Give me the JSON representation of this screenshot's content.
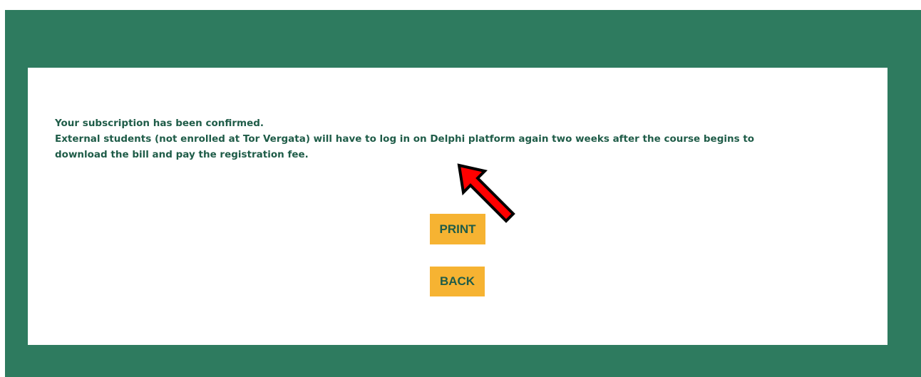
{
  "message": {
    "line1": "Your subscription has been confirmed.",
    "line2": "External students (not enrolled at Tor Vergata) will have to log in on Delphi platform again two weeks after the course begins to",
    "line3": "download the bill and pay the registration fee."
  },
  "buttons": {
    "print_label": "PRINT",
    "back_label": "BACK"
  },
  "annotation": {
    "icon": "red-arrow-pointer-icon",
    "color": "#ff0000"
  },
  "colors": {
    "frame": "#2e7b5f",
    "button": "#f6b332",
    "text": "#1f5c48"
  }
}
